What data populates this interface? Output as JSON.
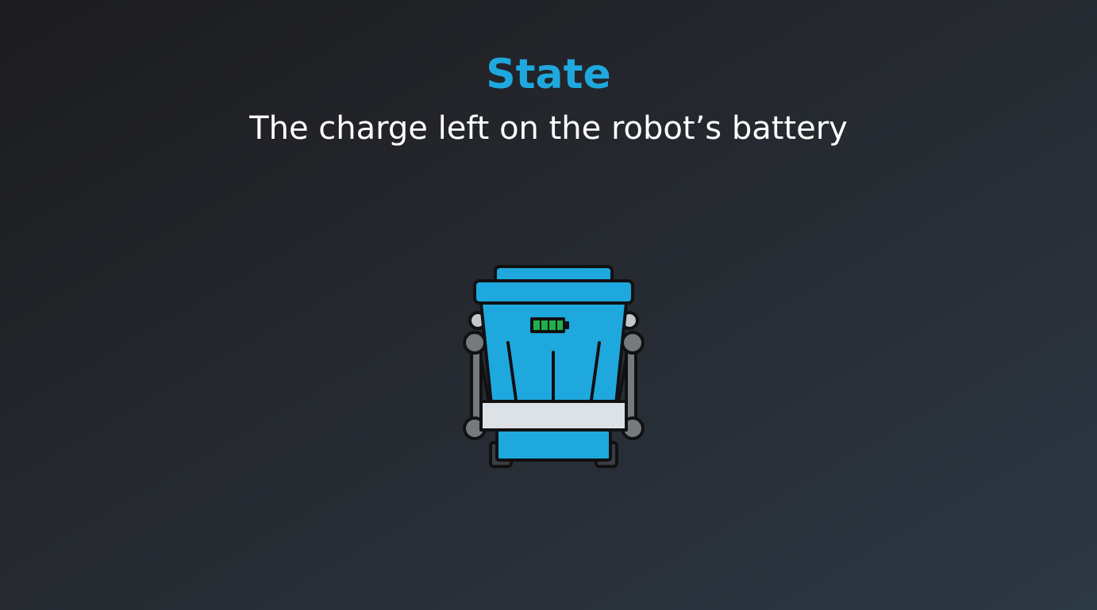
{
  "slide": {
    "title": "State",
    "subtitle": "The charge left on the robot’s battery"
  },
  "illustration": {
    "icon": "robot-vacuum-icon",
    "battery_icon": "battery-full-icon",
    "battery_level": 1.0,
    "colors": {
      "title": "#1fa8de",
      "robot_body": "#1fa8de",
      "outline": "#111111",
      "frame": "#76797d",
      "bumper": "#dde2e6",
      "battery": "#20b04b"
    }
  }
}
